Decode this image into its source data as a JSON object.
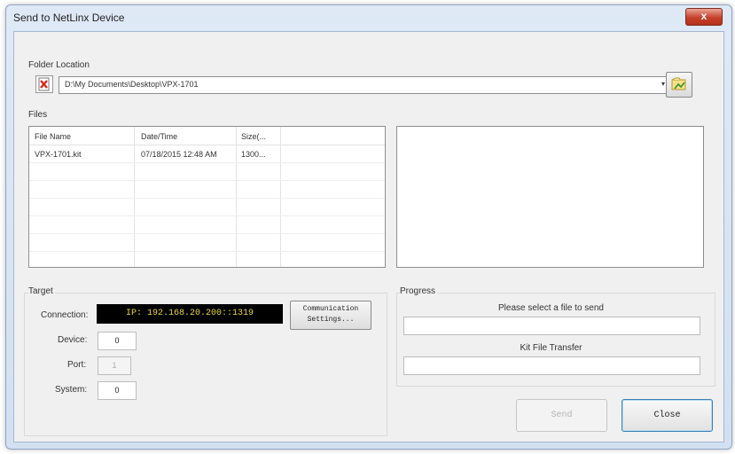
{
  "window": {
    "title": "Send to NetLinx Device",
    "close_symbol": "x"
  },
  "folder": {
    "section_label": "Folder Location",
    "path": "D:\\My Documents\\Desktop\\VPX-1701",
    "dropdown_symbol": "▾",
    "icon": "delete-file-icon",
    "browse_icon": "folder-browse-icon"
  },
  "files": {
    "section_label": "Files",
    "columns": [
      "File Name",
      "Date/Time",
      "Size(..."
    ],
    "rows": [
      {
        "name": "VPX-1701.kit",
        "datetime": "07/18/2015  12:48 AM",
        "size": "1300..."
      }
    ]
  },
  "target": {
    "section_label": "Target",
    "connection_label": "Connection:",
    "connection_value": "IP: 192.168.20.200::1319",
    "comm_settings_line1": "Communication",
    "comm_settings_line2": "Settings...",
    "device_label": "Device:",
    "device_value": "0",
    "port_label": "Port:",
    "port_value": "1",
    "system_label": "System:",
    "system_value": "0"
  },
  "progress": {
    "section_label": "Progress",
    "status_text": "Please select a file to send",
    "file_progress": 0,
    "transfer_label": "Kit File Transfer",
    "transfer_progress": 0
  },
  "buttons": {
    "send": "Send",
    "close": "Close"
  }
}
